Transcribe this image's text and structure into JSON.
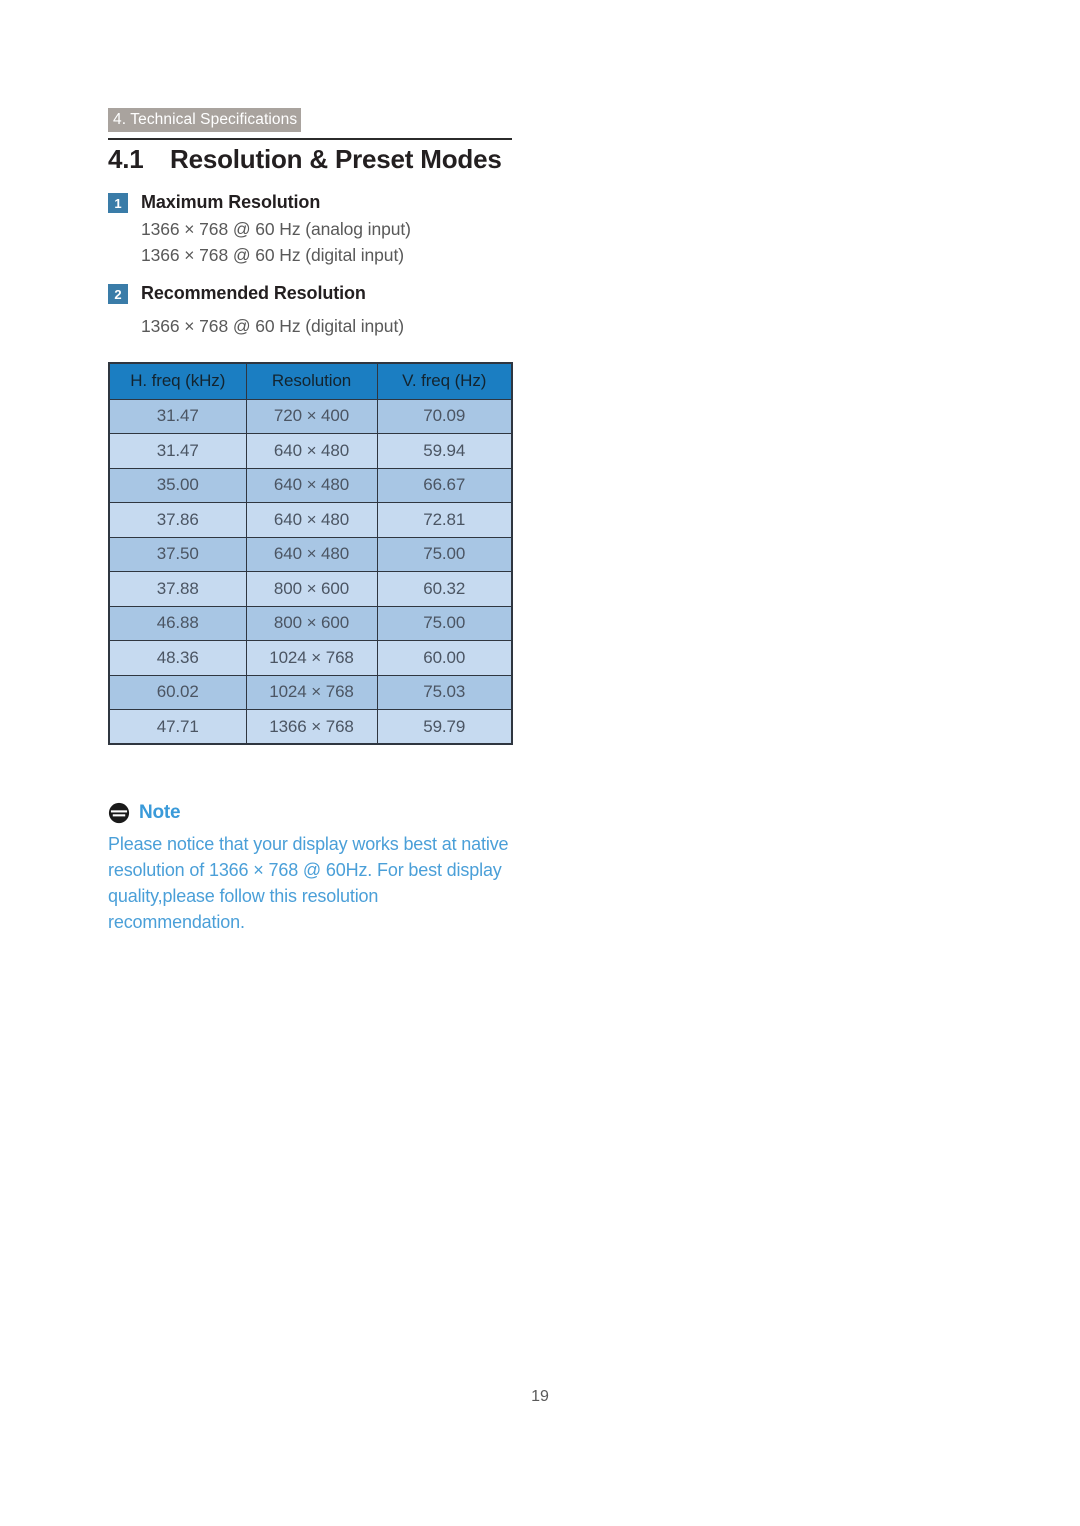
{
  "header": {
    "chapter_band": "4. Technical Specifications",
    "section_number": "4.1",
    "section_title": "Resolution & Preset Modes"
  },
  "items": [
    {
      "badge": "1",
      "title": "Maximum Resolution",
      "lines": [
        "1366 × 768 @ 60 Hz (analog input)",
        "1366 × 768 @ 60 Hz (digital input)"
      ]
    },
    {
      "badge": "2",
      "title": "Recommended Resolution",
      "lines": [
        "1366 × 768 @ 60 Hz (digital input)"
      ]
    }
  ],
  "table": {
    "columns": [
      "H. freq (kHz)",
      "Resolution",
      "V. freq (Hz)"
    ],
    "rows": [
      [
        "31.47",
        "720 × 400",
        "70.09"
      ],
      [
        "31.47",
        "640 × 480",
        "59.94"
      ],
      [
        "35.00",
        "640 × 480",
        "66.67"
      ],
      [
        "37.86",
        "640 × 480",
        "72.81"
      ],
      [
        "37.50",
        "640 × 480",
        "75.00"
      ],
      [
        "37.88",
        "800 × 600",
        "60.32"
      ],
      [
        "46.88",
        "800 × 600",
        "75.00"
      ],
      [
        "48.36",
        "1024 × 768",
        "60.00"
      ],
      [
        "60.02",
        "1024 × 768",
        "75.03"
      ],
      [
        "47.71",
        "1366 × 768",
        "59.79"
      ]
    ]
  },
  "note": {
    "icon": "note-circle-icon",
    "label": "Note",
    "body": "Please notice that your display works best at native resolution of 1366 × 768 @ 60Hz. For best display quality,please follow this resolution recommendation."
  },
  "footer": {
    "page_number": "19"
  },
  "colors": {
    "band_gray": "#a9a39e",
    "badge_blue": "#3a7ca8",
    "table_header_blue": "#1b7ec2",
    "row_odd_blue": "#a8c6e4",
    "row_even_blue": "#c6daf0",
    "note_blue": "#4a9fd8",
    "body_gray": "#595959",
    "heading_black": "#231f20"
  }
}
